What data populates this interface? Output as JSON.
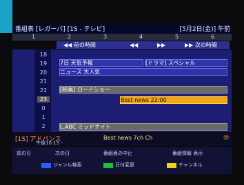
{
  "header": {
    "title": "番組表 [レガーバ] [1S - テレビ]",
    "datetime": "[5月2日(金)] 午前"
  },
  "channels": [
    "1",
    "2",
    "3",
    "4",
    "5",
    "6"
  ],
  "nav": {
    "prev": "◀◀ 前の時間",
    "mid_left": "◀◀",
    "mid_right": "▶▶",
    "next": "▶▶ 次の時間"
  },
  "times": [
    "18",
    "19",
    "20",
    "21",
    "22",
    "23",
    "0",
    "1",
    "2"
  ],
  "programs": [
    {
      "label": "7日 天気予報",
      "state": "normal"
    },
    {
      "label": "[ドラマ] スペシャル",
      "state": "normal"
    },
    {
      "label": "ニュース 大人気",
      "state": "normal"
    },
    {
      "label": "[映画] ロードショー",
      "state": "gray"
    },
    {
      "label": "Best news 22:00",
      "state": "sel"
    },
    {
      "label": "L.ABC ミッドナイト",
      "state": "gray"
    }
  ],
  "info": {
    "left": "[1S] アドバンス",
    "sub": "午後10:15 -",
    "mid": "Best news 7ch Ch",
    "right": "◎"
  },
  "bottom": {
    "btn1": "前の日",
    "btn2": "次の日",
    "btn3": "番組表の中止",
    "btn4": "番組情報 表示",
    "btn5": "ジャンル検索",
    "btn6": "日付変更",
    "btn7": "チャンネル"
  }
}
